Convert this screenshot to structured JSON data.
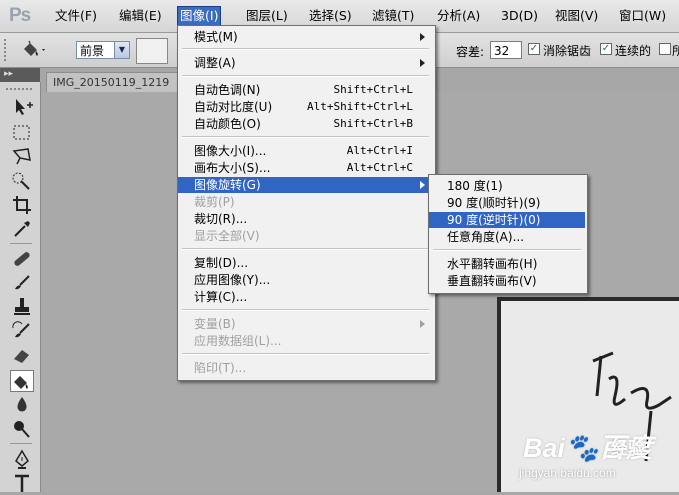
{
  "app": {
    "logo": "Ps"
  },
  "menubar": {
    "items": [
      "文件(F)",
      "编辑(E)",
      "图像(I)",
      "图层(L)",
      "选择(S)",
      "滤镜(T)",
      "分析(A)",
      "3D(D)",
      "视图(V)",
      "窗口(W)"
    ],
    "open_item": "图像(I)"
  },
  "options": {
    "fill_source": "前景",
    "tolerance_label": "容差:",
    "tolerance_value": "32",
    "antialias_label": "消除锯齿",
    "antialias_checked": true,
    "contiguous_label": "连续的",
    "contiguous_checked": true,
    "all_layers_label": "所",
    "all_layers_checked": false
  },
  "document": {
    "tab_title": "IMG_20150119_1219"
  },
  "image_menu": {
    "items": [
      {
        "label": "模式(M)",
        "shortcut": "",
        "submenu": true,
        "disabled": false
      },
      {
        "label": "调整(A)",
        "shortcut": "",
        "submenu": true,
        "disabled": false
      },
      {
        "label": "自动色调(N)",
        "shortcut": "Shift+Ctrl+L",
        "submenu": false,
        "disabled": false
      },
      {
        "label": "自动对比度(U)",
        "shortcut": "Alt+Shift+Ctrl+L",
        "submenu": false,
        "disabled": false
      },
      {
        "label": "自动颜色(O)",
        "shortcut": "Shift+Ctrl+B",
        "submenu": false,
        "disabled": false
      },
      {
        "label": "图像大小(I)...",
        "shortcut": "Alt+Ctrl+I",
        "submenu": false,
        "disabled": false
      },
      {
        "label": "画布大小(S)...",
        "shortcut": "Alt+Ctrl+C",
        "submenu": false,
        "disabled": false
      },
      {
        "label": "图像旋转(G)",
        "shortcut": "",
        "submenu": true,
        "disabled": false,
        "highlighted": true
      },
      {
        "label": "裁剪(P)",
        "shortcut": "",
        "submenu": false,
        "disabled": true
      },
      {
        "label": "裁切(R)...",
        "shortcut": "",
        "submenu": false,
        "disabled": false
      },
      {
        "label": "显示全部(V)",
        "shortcut": "",
        "submenu": false,
        "disabled": true
      },
      {
        "label": "复制(D)...",
        "shortcut": "",
        "submenu": false,
        "disabled": false
      },
      {
        "label": "应用图像(Y)...",
        "shortcut": "",
        "submenu": false,
        "disabled": false
      },
      {
        "label": "计算(C)...",
        "shortcut": "",
        "submenu": false,
        "disabled": false
      },
      {
        "label": "变量(B)",
        "shortcut": "",
        "submenu": true,
        "disabled": true
      },
      {
        "label": "应用数据组(L)...",
        "shortcut": "",
        "submenu": false,
        "disabled": true
      },
      {
        "label": "陷印(T)...",
        "shortcut": "",
        "submenu": false,
        "disabled": true
      }
    ]
  },
  "rotate_submenu": {
    "items": [
      {
        "label": "180 度(1)",
        "highlighted": false
      },
      {
        "label": "90 度(顺时针)(9)",
        "highlighted": false
      },
      {
        "label": "90 度(逆时针)(0)",
        "highlighted": true
      },
      {
        "label": "任意角度(A)...",
        "highlighted": false
      },
      {
        "label": "水平翻转画布(H)",
        "highlighted": false
      },
      {
        "label": "垂直翻转画布(V)",
        "highlighted": false
      }
    ]
  },
  "watermark": {
    "logo": "Bai🐾百度",
    "sub": "经验",
    "url": "jingyan.baidu.com"
  },
  "colors": {
    "menu_highlight": "#3165c4",
    "menu_open": "#3a6cc0",
    "canvas_bg": "#a9a9a9"
  }
}
